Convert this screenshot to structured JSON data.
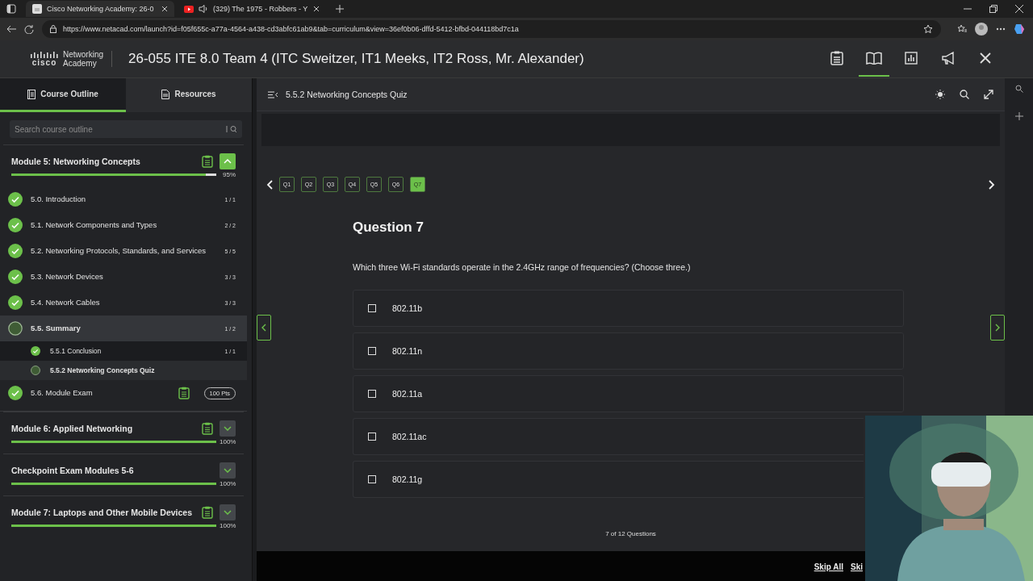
{
  "browser": {
    "tabs": [
      {
        "title": "Cisco Networking Academy: 26-0",
        "selected": true,
        "kind": "site",
        "audio": false
      },
      {
        "title": "(329) The 1975 - Robbers - Y",
        "selected": false,
        "kind": "video",
        "audio": true
      }
    ],
    "url": "https://www.netacad.com/launch?id=f05f655c-a77a-4564-a438-cd3abfc61ab9&tab=curriculum&view=36ef0b06-dffd-5412-bfbd-044118bd7c1a"
  },
  "header": {
    "logo": {
      "wordmark": "cisco",
      "line1": "Networking",
      "line2": "Academy"
    },
    "title": "26-055 ITE 8.0 Team 4 (ITC Sweitzer, IT1 Meeks, IT2 Ross, Mr. Alexander)",
    "icons": [
      {
        "kind": "clipboard",
        "selected": false
      },
      {
        "kind": "book",
        "selected": true
      },
      {
        "kind": "chart",
        "selected": false
      },
      {
        "kind": "megaphone",
        "selected": false
      },
      {
        "kind": "close",
        "selected": false
      }
    ]
  },
  "sidebar": {
    "tabs": [
      {
        "label": "Course Outline",
        "kind": "outline",
        "selected": true
      },
      {
        "label": "Resources",
        "kind": "resources",
        "selected": false
      }
    ],
    "search": {
      "placeholder": "Search course outline"
    },
    "modules": [
      {
        "title": "Module 5: Networking Concepts",
        "percent": "95%",
        "level": 0.95,
        "expanded": true,
        "clipboard": true,
        "sections": [
          {
            "label": "5.0. Introduction",
            "progress": "1 / 1",
            "completed": true,
            "selected": false
          },
          {
            "label": "5.1. Network Components and Types",
            "progress": "2 / 2",
            "completed": true,
            "selected": false
          },
          {
            "label": "5.2. Networking Protocols, Standards, and Services",
            "progress": "5 / 5",
            "completed": true,
            "selected": false
          },
          {
            "label": "5.3. Network Devices",
            "progress": "3 / 3",
            "completed": true,
            "selected": false
          },
          {
            "label": "5.4. Network Cables",
            "progress": "3 / 3",
            "completed": true,
            "selected": false
          },
          {
            "label": "5.5. Summary",
            "progress": "1 / 2",
            "completed": false,
            "selected": true,
            "children": [
              {
                "label": "5.5.1 Conclusion",
                "progress": "1 / 1",
                "completed": true,
                "selected": false
              },
              {
                "label": "5.5.2 Networking Concepts Quiz",
                "completed": false,
                "selected": true
              }
            ]
          },
          {
            "label": "5.6. Module Exam",
            "badge": "100 Pts",
            "clipboard": true,
            "completed": true,
            "selected": false
          }
        ]
      },
      {
        "title": "Module 6: Applied Networking",
        "percent": "100%",
        "level": 1,
        "expanded": false,
        "clipboard": true
      },
      {
        "title": "Checkpoint Exam Modules 5-6",
        "percent": "100%",
        "level": 1,
        "expanded": false,
        "clipboard": false
      },
      {
        "title": "Module 7: Laptops and Other Mobile Devices",
        "percent": "100%",
        "level": 1,
        "expanded": false,
        "clipboard": true
      }
    ]
  },
  "content": {
    "title": "5.5.2 Networking Concepts Quiz",
    "questions": [
      {
        "label": "Q1",
        "selected": false
      },
      {
        "label": "Q2",
        "selected": false
      },
      {
        "label": "Q3",
        "selected": false
      },
      {
        "label": "Q4",
        "selected": false
      },
      {
        "label": "Q5",
        "selected": false
      },
      {
        "label": "Q6",
        "selected": false
      },
      {
        "label": "Q7",
        "selected": true
      }
    ],
    "heading": "Question 7",
    "prompt": "Which three Wi-Fi standards operate in the 2.4GHz range of frequencies? (Choose three.)",
    "options": [
      {
        "label": "802.11b",
        "checked": false
      },
      {
        "label": "802.11n",
        "checked": false
      },
      {
        "label": "802.11a",
        "checked": false
      },
      {
        "label": "802.11ac",
        "checked": false
      },
      {
        "label": "802.11g",
        "checked": false
      }
    ],
    "counter": "7 of 12 Questions",
    "footer_links": [
      "Skip All",
      "Ski"
    ]
  }
}
